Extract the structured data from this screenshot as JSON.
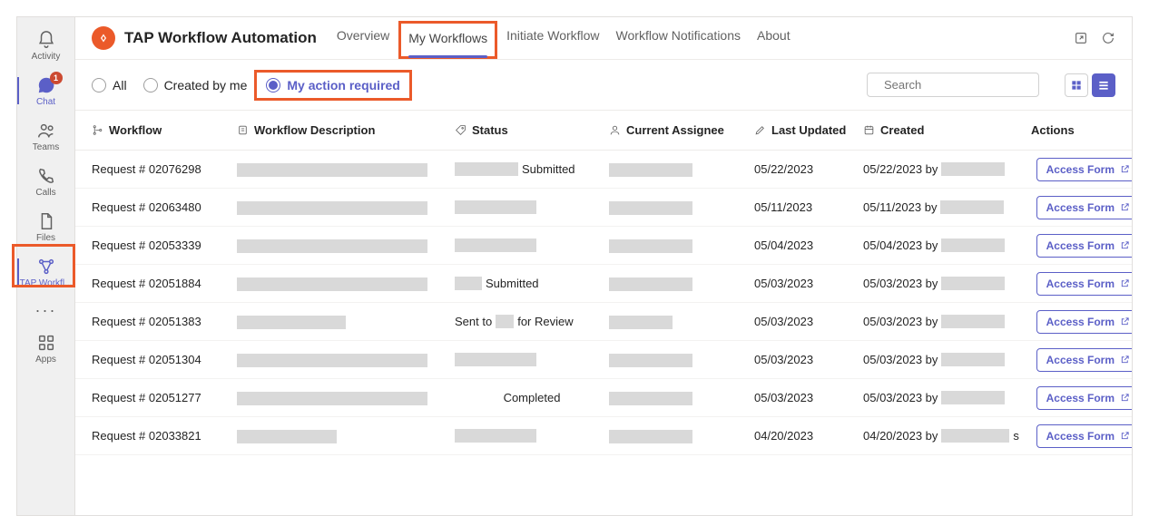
{
  "rail": {
    "items": [
      {
        "name": "activity",
        "label": "Activity"
      },
      {
        "name": "chat",
        "label": "Chat",
        "badge": "1"
      },
      {
        "name": "teams",
        "label": "Teams"
      },
      {
        "name": "calls",
        "label": "Calls"
      },
      {
        "name": "files",
        "label": "Files"
      },
      {
        "name": "tap",
        "label": "TAP Workfl..."
      }
    ],
    "apps_label": "Apps"
  },
  "header": {
    "title": "TAP Workflow Automation",
    "tabs": [
      {
        "label": "Overview"
      },
      {
        "label": "My Workflows",
        "active": true,
        "highlighted": true
      },
      {
        "label": "Initiate Workflow"
      },
      {
        "label": "Workflow Notifications"
      },
      {
        "label": "About"
      }
    ]
  },
  "filters": {
    "options": [
      {
        "label": "All"
      },
      {
        "label": "Created by me"
      },
      {
        "label": "My action required",
        "selected": true,
        "highlighted": true
      }
    ],
    "search_placeholder": "Search"
  },
  "table": {
    "columns": {
      "workflow": "Workflow",
      "description": "Workflow Description",
      "status": "Status",
      "assignee": "Current Assignee",
      "updated": "Last Updated",
      "created": "Created",
      "actions": "Actions"
    },
    "action_label": "Access Form",
    "created_by": "by",
    "rows": [
      {
        "workflow": "Request # 02076298",
        "desc_w": 210,
        "status_pre_w": 70,
        "status_text": "Submitted",
        "assignee_w": 92,
        "updated": "05/22/2023",
        "created": "05/22/2023",
        "created_redact_w": 70
      },
      {
        "workflow": "Request # 02063480",
        "desc_w": 210,
        "status_pre_w": 90,
        "status_text": "",
        "assignee_w": 92,
        "updated": "05/11/2023",
        "created": "05/11/2023",
        "created_redact_w": 70
      },
      {
        "workflow": "Request # 02053339",
        "desc_w": 210,
        "status_pre_w": 90,
        "status_text": "",
        "assignee_w": 92,
        "updated": "05/04/2023",
        "created": "05/04/2023",
        "created_redact_w": 70
      },
      {
        "workflow": "Request # 02051884",
        "desc_w": 210,
        "status_pre_w": 30,
        "status_text": "Submitted",
        "assignee_w": 92,
        "updated": "05/03/2023",
        "created": "05/03/2023",
        "created_redact_w": 70
      },
      {
        "workflow": "Request # 02051383",
        "desc_w": 120,
        "status_custom": {
          "pre": "Sent to",
          "mid_w": 20,
          "post": "for Review"
        },
        "assignee_w": 70,
        "updated": "05/03/2023",
        "created": "05/03/2023",
        "created_redact_w": 70
      },
      {
        "workflow": "Request # 02051304",
        "desc_w": 210,
        "status_pre_w": 90,
        "status_text": "",
        "assignee_w": 92,
        "updated": "05/03/2023",
        "created": "05/03/2023",
        "created_redact_w": 70
      },
      {
        "workflow": "Request # 02051277",
        "desc_w": 210,
        "status_text_only": "Completed",
        "assignee_w": 92,
        "updated": "05/03/2023",
        "created": "05/03/2023",
        "created_redact_w": 70
      },
      {
        "workflow": "Request # 02033821",
        "desc_w": 110,
        "status_pre_w": 90,
        "status_text": "",
        "assignee_w": 92,
        "updated": "04/20/2023",
        "created": "04/20/2023",
        "created_redact_w": 75,
        "created_trail": "s"
      }
    ]
  }
}
